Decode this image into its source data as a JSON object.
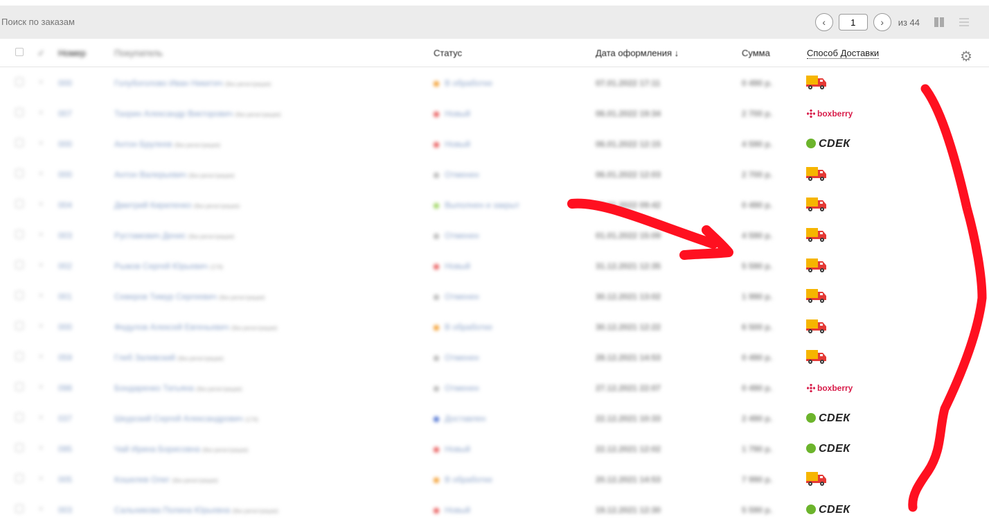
{
  "toolbar": {
    "search_placeholder": "Поиск по заказам",
    "page_value": "1",
    "page_total": "из 44",
    "prev_icon": "chevron-left-icon",
    "next_icon": "chevron-right-icon"
  },
  "columns": {
    "number": "Номер",
    "buyer": "Покупатель",
    "status": "Статус",
    "date": "Дата оформления ↓",
    "sum": "Сумма",
    "delivery": "Способ Доставки"
  },
  "colors": {
    "status_processing": "#f39c2b",
    "status_new": "#e85858",
    "status_cancelled": "#b5b5b5",
    "status_done": "#9ad35a",
    "status_delivered": "#4a6fd1",
    "annotation": "#ff1020"
  },
  "delivery_labels": {
    "boxberry": "boxberry",
    "cdek": "СDЕК"
  },
  "orders": [
    {
      "num": "000",
      "buyer": "Голубоголово Иван Никитич",
      "note": "(без регистрации)",
      "status": "В обработке",
      "status_key": "processing",
      "date": "07.01.2022 17:11",
      "sum": "0 490 р.",
      "delivery": "truck"
    },
    {
      "num": "007",
      "buyer": "Тахрин Александр Викторович",
      "note": "(без регистрации)",
      "status": "Новый",
      "status_key": "new",
      "date": "06.01.2022 19:34",
      "sum": "2 700 р.",
      "delivery": "boxberry"
    },
    {
      "num": "000",
      "buyer": "Антон Брулеев",
      "note": "(без регистрации)",
      "status": "Новый",
      "status_key": "new",
      "date": "06.01.2022 12:15",
      "sum": "4 590 р.",
      "delivery": "cdek"
    },
    {
      "num": "000",
      "buyer": "Антон Валерьевич",
      "note": "(без регистрации)",
      "status": "Отменен",
      "status_key": "cancelled",
      "date": "06.01.2022 12:03",
      "sum": "2 700 р.",
      "delivery": "truck"
    },
    {
      "num": "004",
      "buyer": "Дмитрий Кириленко",
      "note": "(без регистрации)",
      "status": "Выполнен и закрыт",
      "status_key": "done",
      "date": "03.01.2022 09:42",
      "sum": "0 490 р.",
      "delivery": "truck"
    },
    {
      "num": "003",
      "buyer": "Рустамович Денис",
      "note": "(без регистрации)",
      "status": "Отменен",
      "status_key": "cancelled",
      "date": "01.01.2022 15:09",
      "sum": "4 590 р.",
      "delivery": "truck"
    },
    {
      "num": "002",
      "buyer": "Рыжов Сергей Юрьевич",
      "note": "(174)",
      "status": "Новый",
      "status_key": "new",
      "date": "31.12.2021 12:35",
      "sum": "5 590 р.",
      "delivery": "truck"
    },
    {
      "num": "001",
      "buyer": "Северов Тимур Сергеевич",
      "note": "(без регистрации)",
      "status": "Отменен",
      "status_key": "cancelled",
      "date": "30.12.2021 13:02",
      "sum": "1 990 р.",
      "delivery": "truck"
    },
    {
      "num": "000",
      "buyer": "Федулов Алексей Евгеньевич",
      "note": "(без регистрации)",
      "status": "В обработке",
      "status_key": "processing",
      "date": "30.12.2021 12:22",
      "sum": "6 500 р.",
      "delivery": "truck"
    },
    {
      "num": "059",
      "buyer": "Глеб Заливский",
      "note": "(без регистрации)",
      "status": "Отменен",
      "status_key": "cancelled",
      "date": "28.12.2021 14:53",
      "sum": "0 490 р.",
      "delivery": "truck"
    },
    {
      "num": "098",
      "buyer": "Бондаренко Татьяна",
      "note": "(без регистрации)",
      "status": "Отменен",
      "status_key": "cancelled",
      "date": "27.12.2021 22:07",
      "sum": "0 490 р.",
      "delivery": "boxberry"
    },
    {
      "num": "037",
      "buyer": "Шкурский Сергей Александрович",
      "note": "(174)",
      "status": "Доставлен",
      "status_key": "delivered",
      "date": "22.12.2021 10:33",
      "sum": "2 490 р.",
      "delivery": "cdek"
    },
    {
      "num": "095",
      "buyer": "Чай Ирина Борисовна",
      "note": "(без регистрации)",
      "status": "Новый",
      "status_key": "new",
      "date": "22.12.2021 12:02",
      "sum": "1 790 р.",
      "delivery": "cdek"
    },
    {
      "num": "005",
      "buyer": "Кошелев Олег",
      "note": "(без регистрации)",
      "status": "В обработке",
      "status_key": "processing",
      "date": "20.12.2021 14:53",
      "sum": "7 990 р.",
      "delivery": "truck"
    },
    {
      "num": "003",
      "buyer": "Сальникова Полина Юрьевна",
      "note": "(без регистрации)",
      "status": "Новый",
      "status_key": "new",
      "date": "19.12.2021 12:30",
      "sum": "5 590 р.",
      "delivery": "cdek"
    }
  ]
}
